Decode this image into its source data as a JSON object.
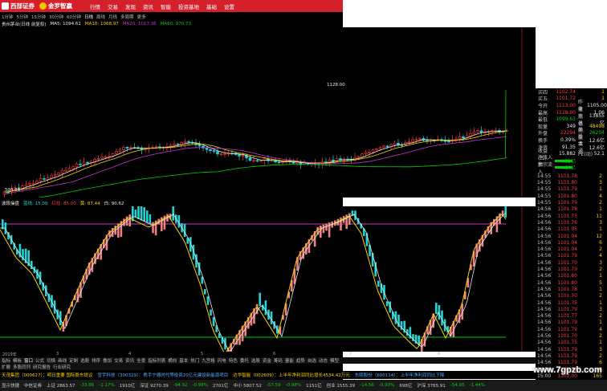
{
  "brand": {
    "name": "西部证券",
    "partner": "金罗智赢"
  },
  "menu": [
    "行情",
    "交易",
    "发现",
    "资讯",
    "智能",
    "投资基地",
    "基础",
    "设置"
  ],
  "periods": [
    "1分钟",
    "5分钟",
    "15分钟",
    "30分钟",
    "60分钟",
    "日线",
    "周线",
    "月线",
    "多周期",
    "更多"
  ],
  "ma_row": {
    "title": "贵州茅台(日线 前复权)",
    "ma5": "MA5: 1094.61",
    "ma10": "MA10: 1068.97",
    "ma20": "MA20: 1017.36",
    "ma60": "MA60: 970.73"
  },
  "price_labels": {
    "high": "1128.00",
    "low": "539.56"
  },
  "indicator_row": {
    "name": "波段操盘",
    "l1": "蓝线: 15.00",
    "l2": "红柱: 85.00",
    "l3": "黄: 87.44",
    "l4": "白: 90.62"
  },
  "quote": {
    "rows": [
      {
        "l": "买四",
        "v": "1102.74",
        "vc": "red",
        "l2": "",
        "v2": "1",
        "v2c": "yellow"
      },
      {
        "l": "买五",
        "v": "1101.72",
        "vc": "red",
        "l2": "",
        "v2": "1",
        "v2c": "yellow"
      },
      {
        "l": "今开",
        "v": "1113.00",
        "vc": "red",
        "l2": "昨收",
        "v2": "1105.00",
        "v2c": "white"
      },
      {
        "l": "最高",
        "v": "1128.00",
        "vc": "red",
        "l2": "量比",
        "v2": "1.06",
        "v2c": "white"
      },
      {
        "l": "最低",
        "v": "1099.63",
        "vc": "green",
        "l2": "市值",
        "v2": "13855亿",
        "v2c": "white"
      },
      {
        "l": "现量",
        "v": "349",
        "vc": "white",
        "l2": "总量",
        "v2": "48498",
        "v2c": "yellow"
      },
      {
        "l": "外盘",
        "v": "22294",
        "vc": "red",
        "l2": "内盘",
        "v2": "26204",
        "v2c": "green"
      },
      {
        "l": "换手",
        "v": "0.39%",
        "vc": "white",
        "l2": "股本",
        "v2": "12.6亿",
        "v2c": "white"
      },
      {
        "l": "净资",
        "v": "91.35",
        "vc": "white",
        "l2": "流通",
        "v2": "12.6亿",
        "v2c": "white"
      },
      {
        "l": "收益(三)",
        "v": "15.882",
        "vc": "white",
        "l2": "PE(动)",
        "v2": "52.1",
        "v2c": "white"
      },
      {
        "l": "净流入额",
        "v": "-4.52亿",
        "vc": "green",
        "l2": "",
        "v2": "",
        "v2c": "white"
      },
      {
        "l": "大宗流入",
        "v": "-4.64亿",
        "vc": "green",
        "l2": "",
        "v2": "",
        "v2c": "white"
      }
    ],
    "ticks": [
      {
        "t": "14:55",
        "p": "1101.78",
        "pc": "red",
        "v": "2",
        "vc": "yellow"
      },
      {
        "t": "14:55",
        "p": "1101.80",
        "pc": "red",
        "v": "3",
        "vc": "yellow"
      },
      {
        "t": "14:55",
        "p": "1101.79",
        "pc": "red",
        "v": "1",
        "vc": "yellow"
      },
      {
        "t": "14:55",
        "p": "1101.80",
        "pc": "red",
        "v": "4",
        "vc": "yellow"
      },
      {
        "t": "14:55",
        "p": "1101.79",
        "pc": "red",
        "v": "2",
        "vc": "yellow"
      },
      {
        "t": "14:56",
        "p": "1101.78",
        "pc": "red",
        "v": "1",
        "vc": "yellow"
      },
      {
        "t": "14:56",
        "p": "1101.73",
        "pc": "red",
        "v": "11",
        "vc": "yellow"
      },
      {
        "t": "14:56",
        "p": "1101.76",
        "pc": "red",
        "v": "3",
        "vc": "yellow"
      },
      {
        "t": "14:56",
        "p": "1101.05",
        "pc": "red",
        "v": "1",
        "vc": "yellow"
      },
      {
        "t": "14:56",
        "p": "1101.04",
        "pc": "red",
        "v": "12",
        "vc": "yellow"
      },
      {
        "t": "14:56",
        "p": "1101.04",
        "pc": "red",
        "v": "6",
        "vc": "yellow"
      },
      {
        "t": "14:56",
        "p": "1101.04",
        "pc": "red",
        "v": "2",
        "vc": "yellow"
      },
      {
        "t": "14:56",
        "p": "1101.79",
        "pc": "red",
        "v": "4",
        "vc": "yellow"
      },
      {
        "t": "14:56",
        "p": "1101.70",
        "pc": "red",
        "v": "3",
        "vc": "yellow"
      },
      {
        "t": "14:56",
        "p": "1101.79",
        "pc": "red",
        "v": "2",
        "vc": "yellow"
      },
      {
        "t": "14:56",
        "p": "1101.80",
        "pc": "red",
        "v": "1",
        "vc": "yellow"
      },
      {
        "t": "14:56",
        "p": "1101.80",
        "pc": "red",
        "v": "5",
        "vc": "yellow"
      },
      {
        "t": "14:56",
        "p": "1101.78",
        "pc": "red",
        "v": "1",
        "vc": "yellow"
      },
      {
        "t": "14:56",
        "p": "1101.70",
        "pc": "red",
        "v": "2",
        "vc": "yellow"
      },
      {
        "t": "14:56",
        "p": "1101.75",
        "pc": "red",
        "v": "1",
        "vc": "yellow"
      },
      {
        "t": "14:56",
        "p": "1101.79",
        "pc": "red",
        "v": "3",
        "vc": "yellow"
      },
      {
        "t": "14:56",
        "p": "1101.77",
        "pc": "red",
        "v": "2",
        "vc": "yellow"
      },
      {
        "t": "14:56",
        "p": "1101.79",
        "pc": "red",
        "v": "1",
        "vc": "yellow"
      },
      {
        "t": "14:56",
        "p": "1101.79",
        "pc": "red",
        "v": "4",
        "vc": "yellow"
      },
      {
        "t": "14:56",
        "p": "1101.70",
        "pc": "red",
        "v": "2",
        "vc": "yellow"
      },
      {
        "t": "14:56",
        "p": "1101.75",
        "pc": "red",
        "v": "1",
        "vc": "yellow"
      },
      {
        "t": "14:56",
        "p": "1101.79",
        "pc": "red",
        "v": "3",
        "vc": "yellow"
      },
      {
        "t": "14:56",
        "p": "1101.79",
        "pc": "red",
        "v": "2",
        "vc": "yellow"
      },
      {
        "t": "14:56",
        "p": "1101.79",
        "pc": "red",
        "v": "6",
        "vc": "yellow"
      },
      {
        "t": "14:56",
        "p": "1101.79",
        "pc": "red",
        "v": "8",
        "vc": "yellow"
      },
      {
        "t": "15:00",
        "p": "1102.00",
        "pc": "red",
        "v": "165",
        "vc": "yellow"
      }
    ]
  },
  "tabs": [
    "指标",
    "模板",
    "窗口",
    "公式",
    "切换",
    "画线",
    "定制",
    "选股",
    "排序",
    "叠加",
    "交易",
    "资讯",
    "全景",
    "指标列表",
    "横向",
    "基本",
    "热门",
    "九宫格",
    "闪电",
    "特色",
    "委托",
    "选股",
    "资金",
    "筹码",
    "量能",
    "趋势",
    "自选",
    "动态",
    "模型"
  ],
  "tabs2": [
    "扩展",
    "多股同列",
    "研究报告",
    "行业研究"
  ],
  "dates": [
    "2019年",
    "3",
    "4",
    "5",
    "6",
    "7",
    "8"
  ],
  "news": [
    {
      "t": "天茂集团（000627）：明日重要 国际股东提议",
      "c": "y"
    },
    {
      "t": "宣宇科技（300329）：携手宁德时代等投资20亿元建设新能源项目",
      "c": "b"
    },
    {
      "t": "达华智能（002609）：上半年净利润同比增长4534.42万元",
      "c": "y"
    },
    {
      "t": "东睦股份（600114）：上半年净利润同比下降",
      "c": "b"
    }
  ],
  "status": [
    "显示快捷",
    "中信证券",
    "上证 2863.57",
    "-33.86",
    "-1.17%",
    "1910亿",
    "深证 9270.39",
    "-94.92",
    "-0.98%",
    "2701亿",
    "中小 5807.52",
    "-57.59",
    "-0.98%",
    "1151亿",
    "创业 1555.39",
    "-14.56",
    "-0.93%",
    "698亿",
    "沪深 3765.91",
    "-54.95",
    "-1.44%"
  ],
  "watermark": "www.7gpzb.com",
  "colors": {
    "red": "#ff3b3b",
    "green": "#00d000",
    "cyan": "#22d3d3",
    "salmon": "#f08080",
    "yellow": "#f5d200",
    "magenta": "#cc33cc",
    "brand_red": "#d3202a"
  },
  "chart_data": [
    {
      "type": "candlestick",
      "title": "贵州茅台(日线 前复权)",
      "series": [
        {
          "name": "MA5",
          "values": [
            1094.61
          ]
        },
        {
          "name": "MA10",
          "values": [
            1068.97
          ]
        },
        {
          "name": "MA20",
          "values": [
            1017.36
          ]
        },
        {
          "name": "MA60",
          "values": [
            970.73
          ]
        }
      ],
      "ylim": [
        539.56,
        1128.0
      ]
    },
    {
      "type": "bar",
      "title": "波段操盘",
      "series": [
        {
          "name": "蓝线",
          "values": [
            15.0
          ]
        },
        {
          "name": "红柱",
          "values": [
            85.0
          ]
        },
        {
          "name": "黄",
          "values": [
            87.44
          ]
        },
        {
          "name": "白",
          "values": [
            90.62
          ]
        }
      ]
    }
  ]
}
